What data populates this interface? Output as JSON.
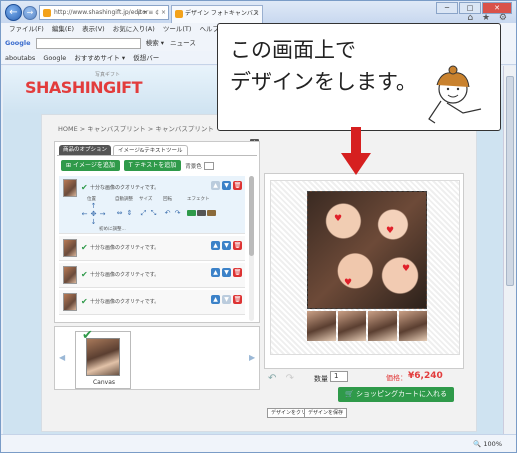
{
  "browser": {
    "address": "http://www.shashingift.jp/editor",
    "address_tools": "ρ ▾ ≡ ¢ ×",
    "tab_title": "デザイン フォトキャンバス",
    "tab_close": "×",
    "win_min": "─",
    "win_max": "□",
    "win_close": "✕",
    "chrome_icons": "⌂ ★ ⚙",
    "menu": [
      "ファイル(F)",
      "編集(E)",
      "表示(V)",
      "お気に入り(A)",
      "ツール(T)",
      "ヘルプ(H)"
    ],
    "google_label": "Google",
    "search_label": "検索 ▾",
    "news_label": "ニュース",
    "favorites": [
      "aboutabs",
      "Google",
      "おすすめサイト ▾",
      "仮想バー"
    ],
    "zoom": "100%"
  },
  "site": {
    "logo": "SHASHINGIFT",
    "logo_sub": "写真ギフト",
    "breadcrumb": "HOME > キャンバスプリント > キャンバスプリント"
  },
  "editor": {
    "tabs": [
      "商品のオプション",
      "イメージ&テキストツール"
    ],
    "info": "i",
    "add_image": "イメージを追加",
    "add_text": "テキストを追加",
    "bg_color": "背景色",
    "quality_text": "十分な画像のクオリティです。",
    "tool_labels": [
      "位置",
      "自動調整",
      "サイズ",
      "回転",
      "エフェクト"
    ],
    "reset_label": "初めに調整...",
    "layers": 4
  },
  "strip": {
    "canvas_label": "Canvas"
  },
  "order": {
    "qty_label": "数量",
    "qty_value": "1",
    "price_label": "価格：",
    "price_value": "¥6,240",
    "cart_button": "ショッピングカートに入れる",
    "clear_button": "デザインをクリア",
    "save_button": "デザインを保存"
  },
  "callout": {
    "line1": "この画面上で",
    "line2": "デザインをします。"
  },
  "colors": {
    "brand_red": "#e23c3c",
    "green": "#2f9a4a",
    "blue": "#3c82c8"
  }
}
